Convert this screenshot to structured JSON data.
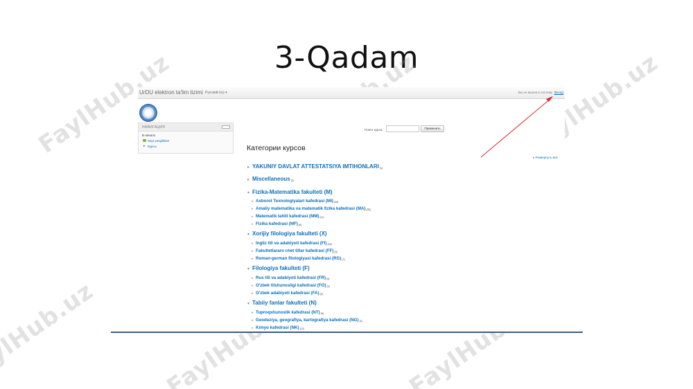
{
  "slide": {
    "title": "3-Qadam"
  },
  "watermark": {
    "text": "FaylHub.uz"
  },
  "header": {
    "site_name": "UrDU elektron ta'lim tizimi",
    "language": "Русский (ru) ▾",
    "login_text": "Вы не вошли в систему",
    "login_link": "(Вход)"
  },
  "navigation": {
    "title": "НАВИГАЦИЯ",
    "home": "В начало",
    "pages": "Sayt yangiliklari",
    "courses": "Курсы"
  },
  "search": {
    "label": "Поиск курса:",
    "button": "Применить"
  },
  "categories_heading": "Категории курсов",
  "expand_all": "Развернуть всё",
  "categories": [
    {
      "name": "YAKUNIY DAVLAT ATTESTATSIYA IMTIHONLARI",
      "count": "(1)",
      "expanded": false
    },
    {
      "name": "Miscellaneous",
      "count": "(2)",
      "expanded": false
    },
    {
      "name": "Fizika-Matematika fakulteti (M)",
      "count": "",
      "expanded": true,
      "subs": [
        {
          "name": "Axborot Texnologiyalari kafedrasi (MI)",
          "count": "(49)"
        },
        {
          "name": "Amaliy matematika va matematik fizika kafedrasi (MA)",
          "count": "(25)"
        },
        {
          "name": "Matematik tahlil kafedrasi (MM)",
          "count": "(11)"
        },
        {
          "name": "Fizika kafedrasi (MF)",
          "count": "(6)"
        }
      ]
    },
    {
      "name": "Xorijiy filologiya fakulteti (X)",
      "count": "",
      "expanded": true,
      "subs": [
        {
          "name": "Ingliz tili va adabiyoti kafedrasi (FI)",
          "count": "(26)"
        },
        {
          "name": "Fakultetlararo chet tillar kafedrasi (FF)",
          "count": "(3)"
        },
        {
          "name": "Roman-german filologiyasi kafedrasi (RG)",
          "count": "(7)"
        }
      ]
    },
    {
      "name": "Filologiya fakulteti (F)",
      "count": "",
      "expanded": true,
      "subs": [
        {
          "name": "Rus tili va adabiyoti kafedrasi (FR)",
          "count": "(4)"
        },
        {
          "name": "O'zbek tilshunosligi kafedrasi (FO)",
          "count": "(2)"
        },
        {
          "name": "O'zbek adabiyoti kafedrasi (FA)",
          "count": "(3)"
        }
      ]
    },
    {
      "name": "Tabiiy fanlar fakulteti (N)",
      "count": "",
      "expanded": true,
      "subs": [
        {
          "name": "Tuproqshunoslik kafedrasi (NT)",
          "count": "(9)"
        },
        {
          "name": "Geodeziya, geografiya, kartografiya kafedrasi (NG)",
          "count": "(2)"
        },
        {
          "name": "Kimyo kafedrasi (NK)",
          "count": "(12)"
        }
      ]
    }
  ],
  "colors": {
    "link": "#0a6ebd",
    "annotation_arrow": "#e0212b",
    "frame_line": "#3a5a85"
  }
}
